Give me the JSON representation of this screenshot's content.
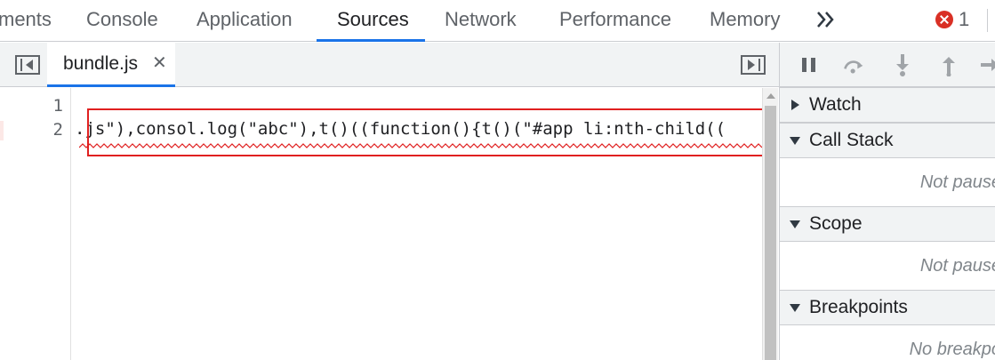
{
  "tabs": [
    {
      "label": "ments"
    },
    {
      "label": "Console"
    },
    {
      "label": "Application"
    },
    {
      "label": "Sources"
    },
    {
      "label": "Network"
    },
    {
      "label": "Performance"
    },
    {
      "label": "Memory"
    }
  ],
  "active_tab": "Sources",
  "more_tabs_icon": "chevron-double-right-icon",
  "error_count": "1",
  "editor": {
    "file_tab": {
      "label": "bundle.js",
      "close": "✕"
    },
    "line_numbers": [
      "1",
      "2"
    ],
    "code_line_2": ".js\"),consol.log(\"abc\"),t()((function(){t()(\"#app li:nth-child(("
  },
  "sidebar": {
    "sections": [
      {
        "label": "Watch",
        "expanded": false
      },
      {
        "label": "Call Stack",
        "expanded": true,
        "status": "Not pause"
      },
      {
        "label": "Scope",
        "expanded": true,
        "status": "Not pause"
      },
      {
        "label": "Breakpoints",
        "expanded": true,
        "status": "No breakpo"
      }
    ]
  },
  "colors": {
    "accent": "#1a73e8",
    "error": "#d93025",
    "highlight_box": "#e02020"
  }
}
